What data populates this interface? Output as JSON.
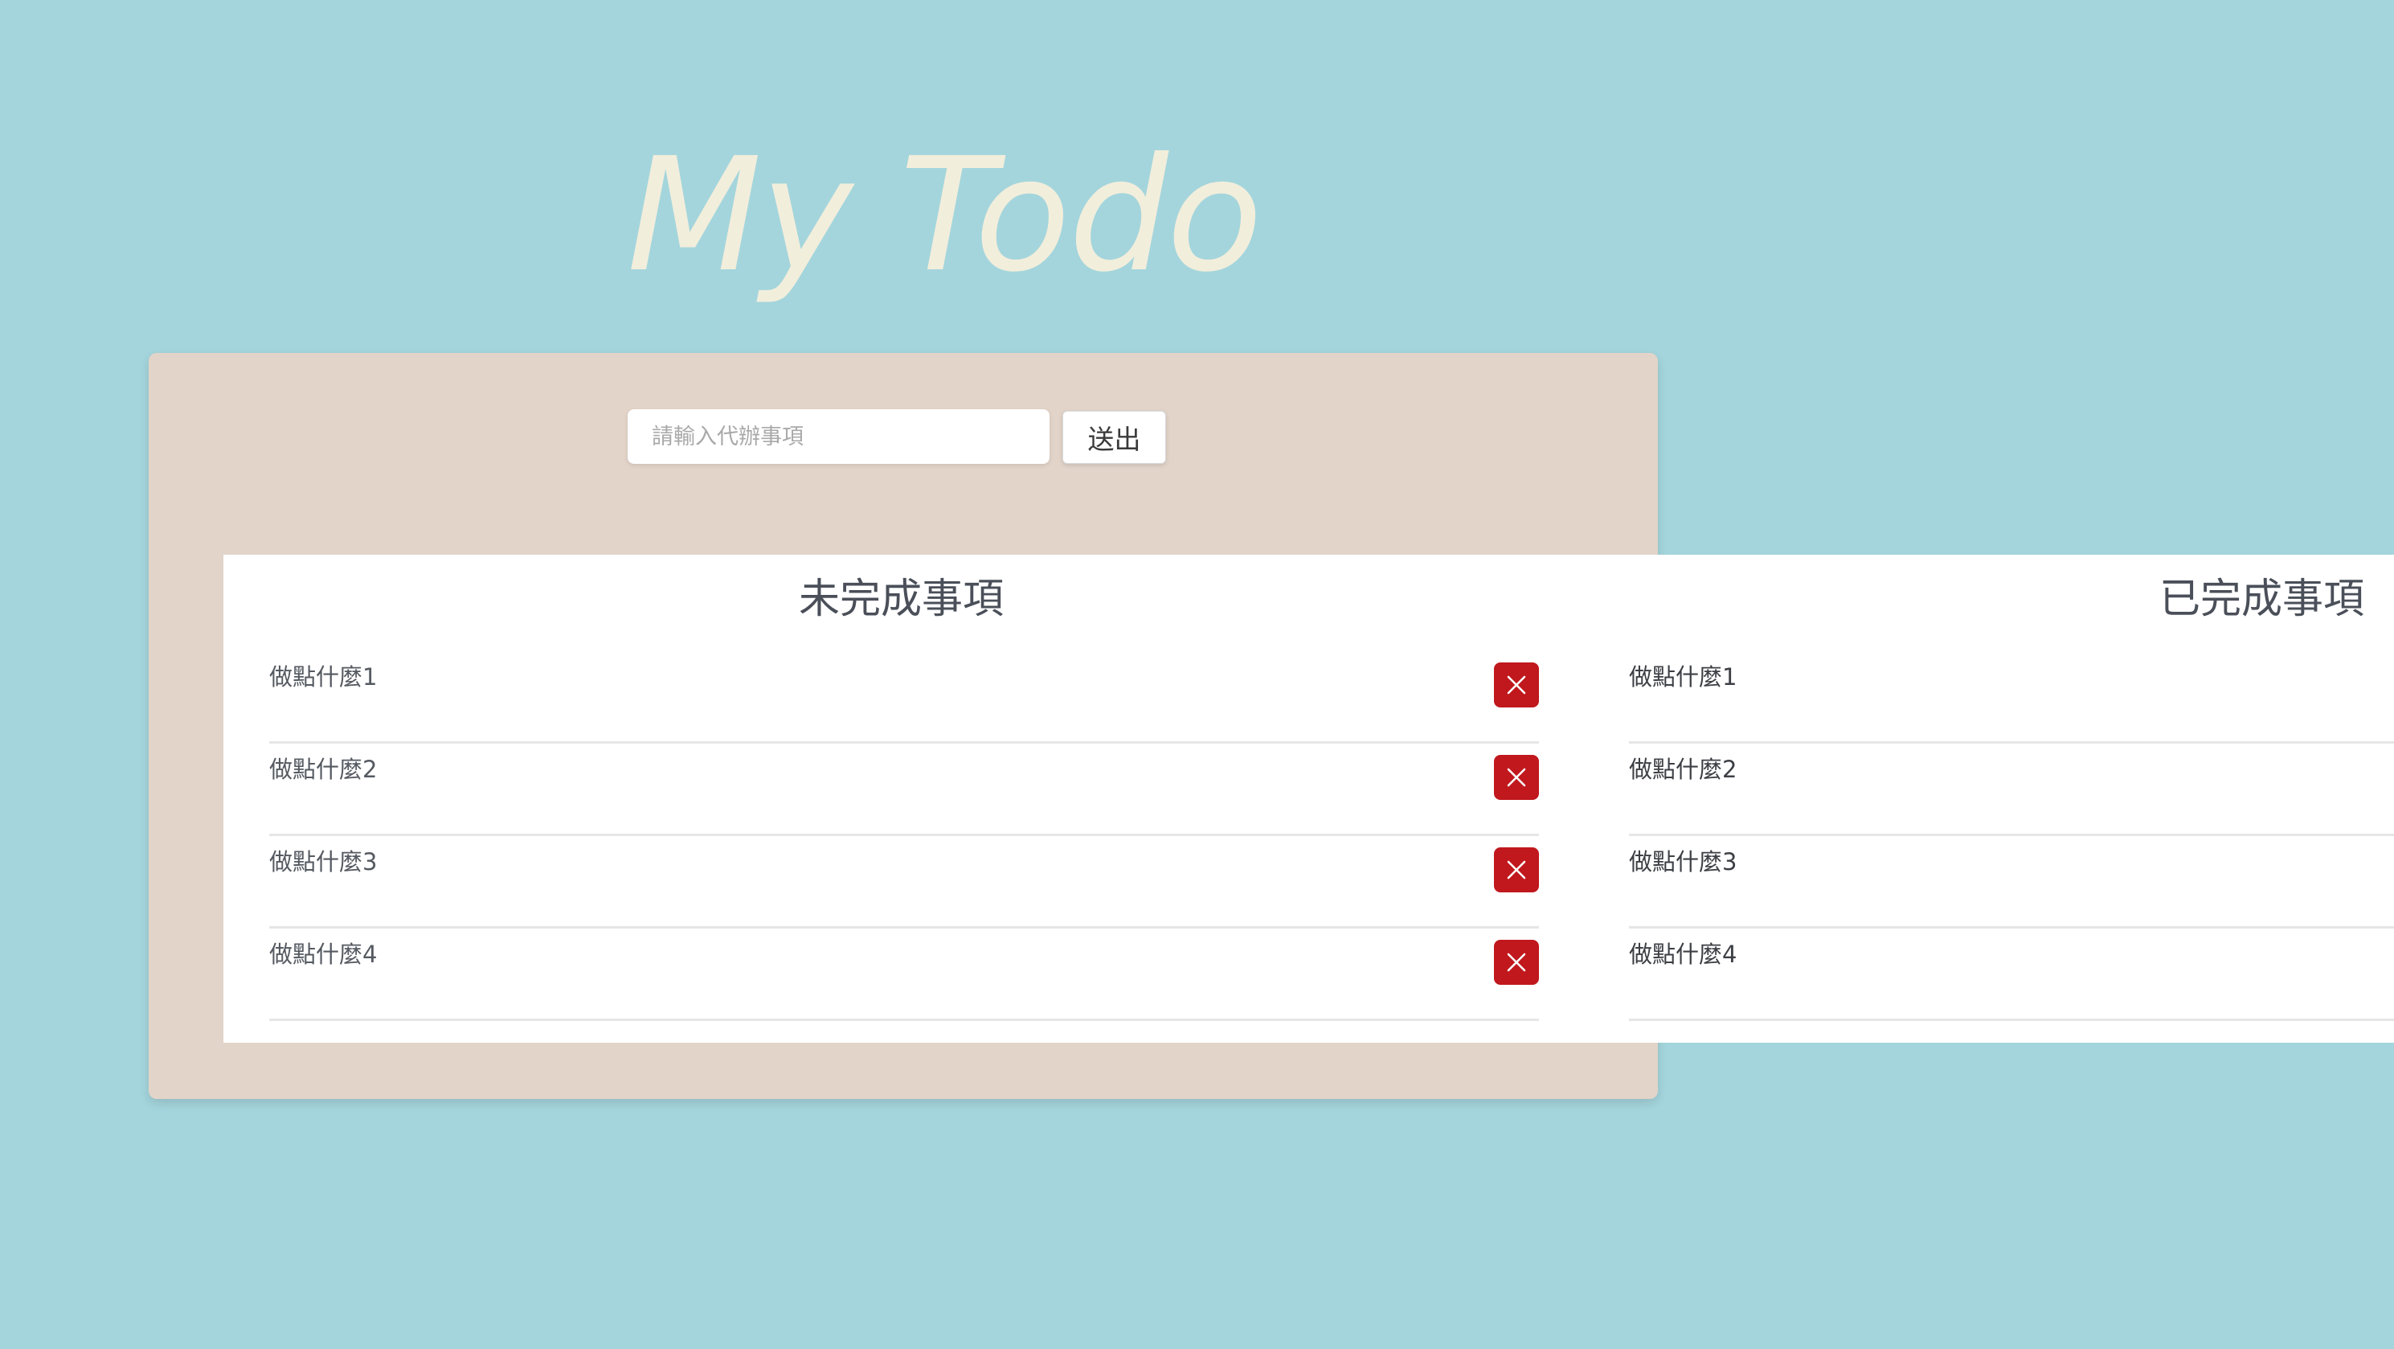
{
  "app": {
    "title": "My Todo"
  },
  "form": {
    "input_value": "",
    "input_placeholder": "請輸入代辦事項",
    "submit_label": "送出"
  },
  "pending": {
    "heading": "未完成事項",
    "items": [
      {
        "text": "做點什麼1",
        "delete_icon": "close-icon"
      },
      {
        "text": "做點什麼2",
        "delete_icon": "close-icon"
      },
      {
        "text": "做點什麼3",
        "delete_icon": "close-icon"
      },
      {
        "text": "做點什麼4",
        "delete_icon": "close-icon"
      }
    ]
  },
  "completed": {
    "heading": "已完成事項",
    "items": [
      {
        "text": "做點什麼1"
      },
      {
        "text": "做點什麼2"
      },
      {
        "text": "做點什麼3"
      },
      {
        "text": "做點什麼4"
      }
    ]
  },
  "colors": {
    "background": "#a4d5dc",
    "card": "#e2d4c9",
    "title": "#f2eedc",
    "delete_button": "#c0181d",
    "panel": "#ffffff"
  }
}
